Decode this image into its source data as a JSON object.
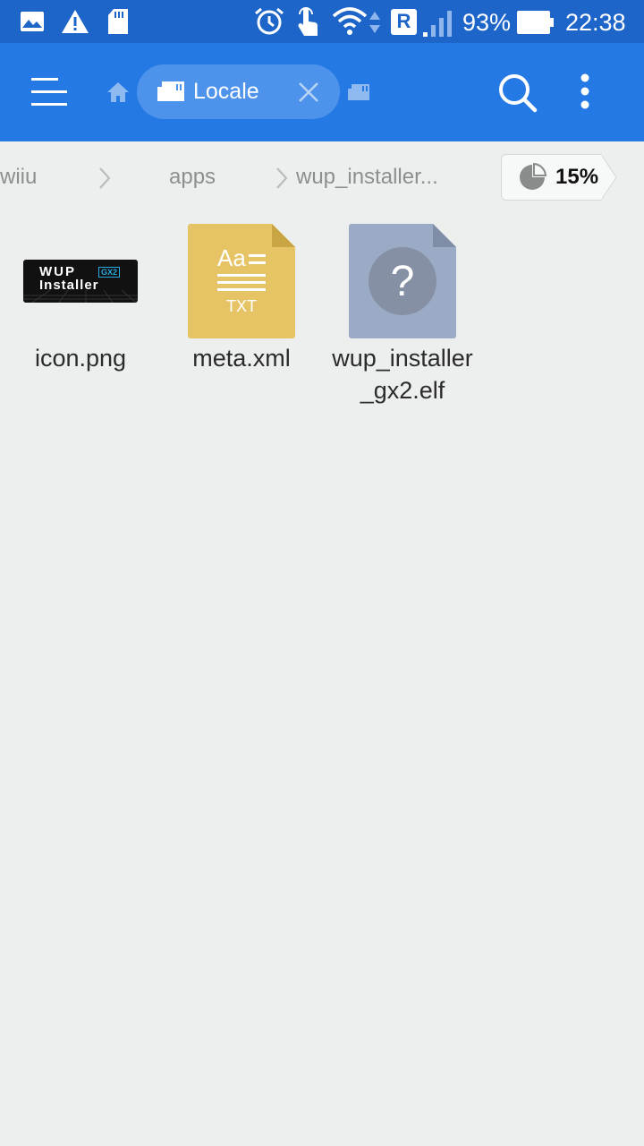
{
  "status_bar": {
    "battery_percent": "93%",
    "time": "22:38",
    "roaming_label": "R",
    "icons": [
      "gallery-icon",
      "warning-icon",
      "sd-card-icon",
      "alarm-icon",
      "touch-icon",
      "wifi-icon",
      "data-arrows-icon",
      "signal-icon",
      "battery-icon"
    ]
  },
  "app_bar": {
    "tab_label": "Locale",
    "icons": [
      "menu-icon",
      "home-icon",
      "sd-card-icon",
      "close-icon",
      "sd-card-icon",
      "search-icon",
      "more-vert-icon"
    ]
  },
  "breadcrumb": {
    "items": [
      "wiiu",
      "apps",
      "wup_installer..."
    ]
  },
  "storage": {
    "usage": "15%"
  },
  "files": [
    {
      "name": "icon.png",
      "type": "image",
      "thumb_line1": "WUP",
      "thumb_line2": "Installer",
      "thumb_badge": "GX2"
    },
    {
      "name": "meta.xml",
      "type": "text",
      "icon_top": "Aa",
      "icon_label": "TXT"
    },
    {
      "name": "wup_installer_gx2.elf",
      "type": "unknown",
      "icon_glyph": "?"
    }
  ],
  "colors": {
    "status_bar_bg": "#1E65C9",
    "app_bar_bg": "#2479E5",
    "page_bg": "#ECEFEE",
    "txt_icon": "#E6C466",
    "unknown_icon": "#9BAAC5"
  }
}
